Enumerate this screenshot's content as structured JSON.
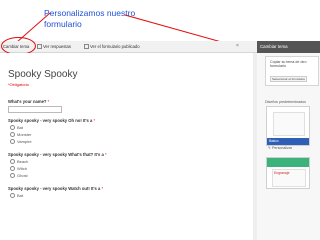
{
  "annotation": {
    "text": "Personalizamos nuestro formulario"
  },
  "toolbar": {
    "change_theme": "Cambiar tema",
    "view_responses": "Ver respuestas",
    "view_published": "Ver el formulario publicado",
    "close": "×"
  },
  "theme_panel": {
    "title": "Cambiar tema",
    "copy_title": "Copiar su tema de otro formulario",
    "copy_link": "Seleccionar el formulario",
    "themes_label": "Diseños predeterminados",
    "theme1_name": "Básico",
    "personalize": "Personalizar",
    "theme2_name": "Engranaje"
  },
  "form": {
    "title": "Spooky Spooky",
    "required_note": "*Obligatorio",
    "questions": [
      {
        "label": "What's your name?",
        "type": "text"
      },
      {
        "label": "Spooky spooky - very spooky Oh no! It's a",
        "options": [
          "Bat",
          "Monster",
          "Vampire"
        ]
      },
      {
        "label": "Spooky spooky - very spooky What's that? It's a",
        "options": [
          "Beach",
          "Witch",
          "Ghost"
        ]
      },
      {
        "label": "Spooky spooky - very spooky Watch out! It's a",
        "options": [
          "Bat"
        ]
      }
    ],
    "required_marker": "*"
  },
  "colors": {
    "annotation": "#1f4fd6",
    "highlight": "#e01010",
    "theme_bar": "#2f60b6",
    "theme_green": "#3bb37b"
  }
}
